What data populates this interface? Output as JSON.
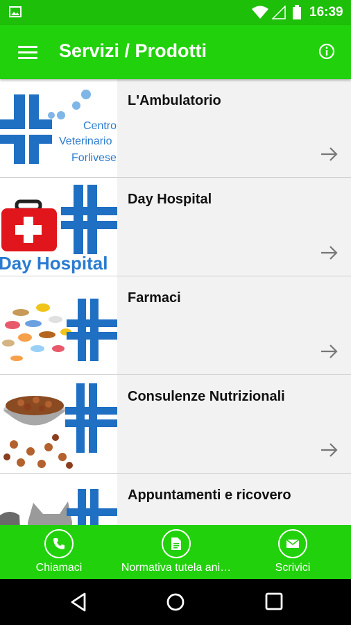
{
  "status_bar": {
    "time": "16:39",
    "icons": [
      "image-icon",
      "wifi-icon",
      "signal-icon",
      "battery-icon"
    ]
  },
  "app_bar": {
    "title": "Servizi / Prodotti",
    "menu_icon": "menu-icon",
    "info_icon": "info-icon"
  },
  "items": [
    {
      "label": "L'Ambulatorio",
      "thumb_text": [
        "Centro",
        "Veterinario",
        "Forlivese"
      ]
    },
    {
      "label": "Day Hospital",
      "thumb_text": [
        "Day Hospital"
      ]
    },
    {
      "label": "Farmaci"
    },
    {
      "label": "Consulenze Nutrizionali"
    },
    {
      "label": "Appuntamenti e ricovero"
    }
  ],
  "bottom_bar": {
    "call_label": "Chiamaci",
    "norm_label": "Normativa tutela ani…",
    "write_label": "Scrivici"
  },
  "colors": {
    "green": "#21d10b",
    "status_green": "#1dbf09",
    "cross_blue": "#1f6fc2"
  }
}
